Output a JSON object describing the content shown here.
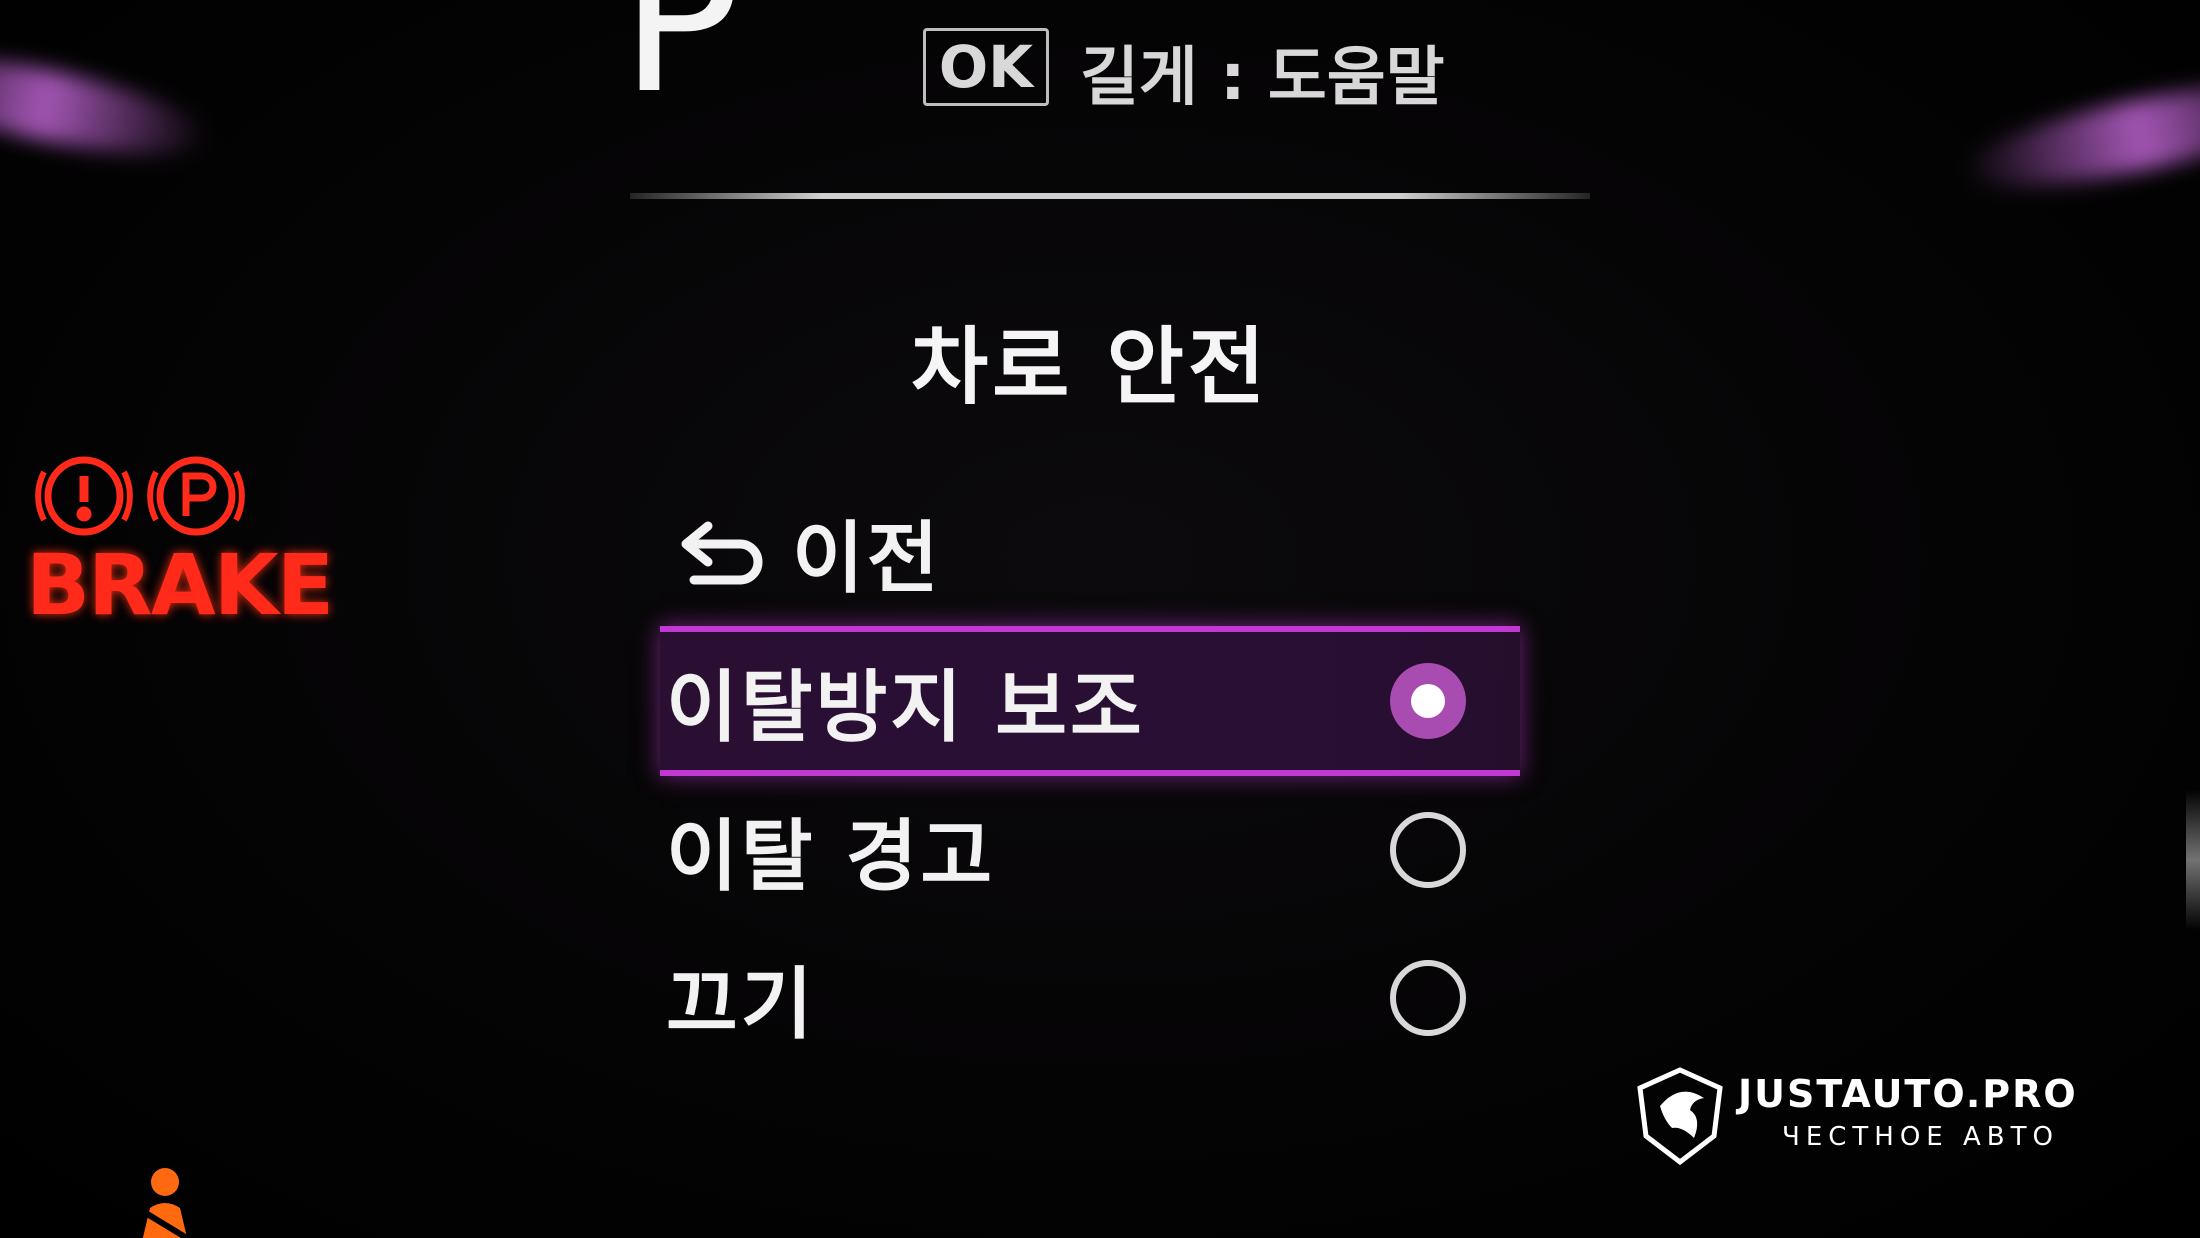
{
  "gear": "P",
  "hint": {
    "key_label": "OK",
    "text": "길게 : 도움말"
  },
  "menu": {
    "title": "차로 안전",
    "back_label": "이전",
    "options": [
      {
        "label": "이탈방지 보조",
        "selected": true
      },
      {
        "label": "이탈 경고",
        "selected": false
      },
      {
        "label": "끄기",
        "selected": false
      }
    ]
  },
  "warning_lights": {
    "brake_label": "BRAKE",
    "brake_color": "#ff2a1a"
  },
  "watermark": {
    "title": "JUSTAUTO.PRO",
    "subtitle": "ЧЕСТНОЕ АВТО"
  },
  "colors": {
    "accent": "#c238d2",
    "selected_radio": "#a84cb2",
    "text": "#f2f2f2"
  },
  "icons": {
    "back": "return-arrow-icon",
    "brake_warning": "brake-warning-icon",
    "parking_brake": "parking-brake-icon",
    "seatbelt": "seatbelt-warning-icon",
    "watermark_logo": "eagle-shield-logo"
  }
}
